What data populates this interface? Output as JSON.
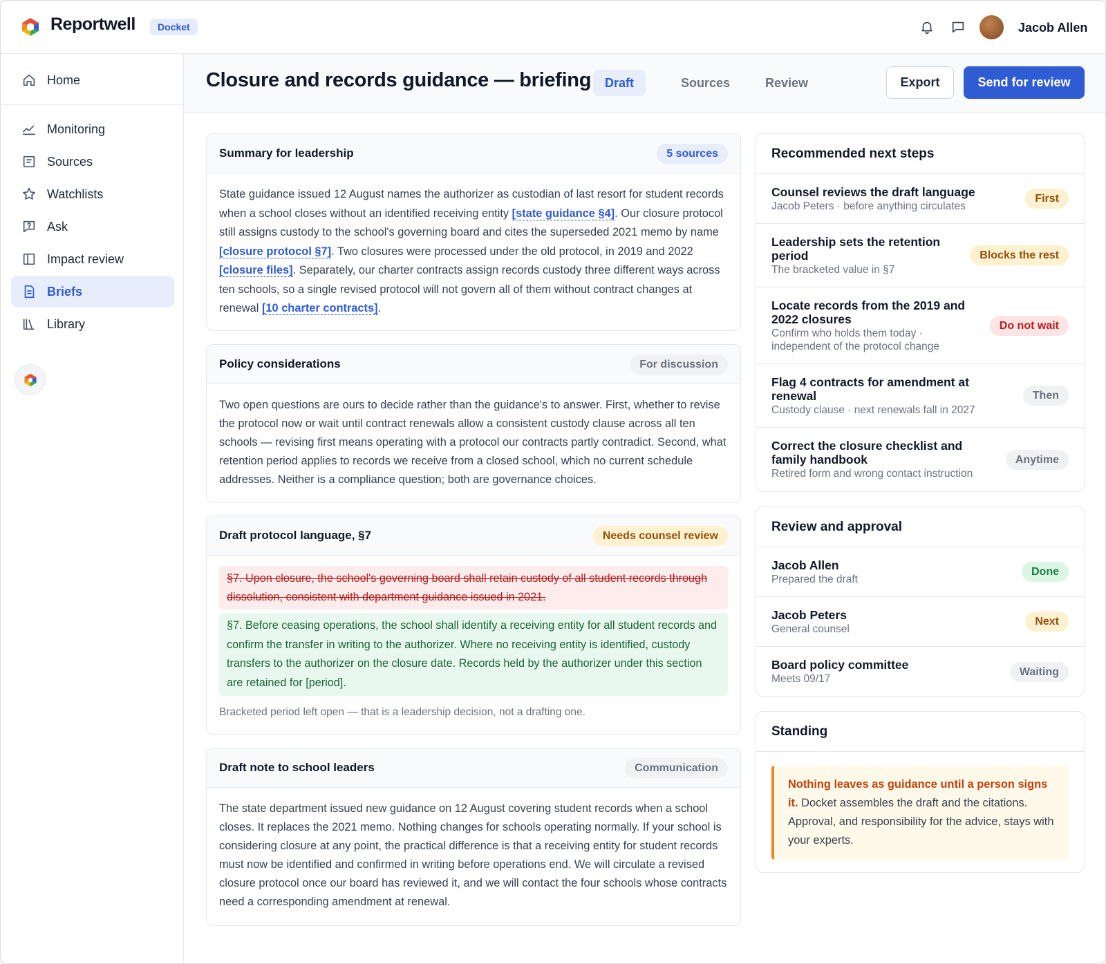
{
  "app": {
    "brand": "Reportwell",
    "product_badge": "Docket",
    "user_name": "Jacob Allen"
  },
  "sidebar": {
    "items": [
      {
        "label": "Home",
        "icon": "home-icon"
      },
      {
        "label": "Monitoring",
        "icon": "trend-icon"
      },
      {
        "label": "Sources",
        "icon": "document-icon"
      },
      {
        "label": "Watchlists",
        "icon": "star-icon"
      },
      {
        "label": "Ask",
        "icon": "chat-question-icon"
      },
      {
        "label": "Impact review",
        "icon": "columns-icon"
      },
      {
        "label": "Briefs",
        "icon": "brief-icon",
        "active": true
      },
      {
        "label": "Library",
        "icon": "library-icon"
      }
    ]
  },
  "header": {
    "title": "Closure and records guidance — briefing",
    "tabs": [
      "Draft",
      "Sources",
      "Review"
    ],
    "active_tab": "Draft",
    "export_label": "Export",
    "send_label": "Send for review"
  },
  "summary": {
    "title": "Summary for leadership",
    "badge": "5 sources",
    "p1": "State guidance issued 12 August names the authorizer as custodian of last resort for student records when a school closes without an identified receiving entity ",
    "c1": "[state guidance §4]",
    "p2": ". Our closure protocol still assigns custody to the school's governing board and cites the superseded 2021 memo by name ",
    "c2": "[closure protocol §7]",
    "p3": ". Two closures were processed under the old protocol, in 2019 and 2022 ",
    "c3": "[closure files]",
    "p4": ". Separately, our charter contracts assign records custody three different ways across ten schools, so a single revised protocol will not govern all of them without contract changes at renewal ",
    "c4": "[10 charter contracts]",
    "p5": "."
  },
  "policy": {
    "title": "Policy considerations",
    "badge": "For discussion",
    "text": "Two open questions are ours to decide rather than the guidance's to answer. First, whether to revise the protocol now or wait until contract renewals allow a consistent custody clause across all ten schools — revising first means operating with a protocol our contracts partly contradict. Second, what retention period applies to records we receive from a closed school, which no current schedule addresses. Neither is a compliance question; both are governance choices."
  },
  "draft": {
    "title": "Draft protocol language, §7",
    "badge": "Needs counsel review",
    "removed": "§7. Upon closure, the school's governing board shall retain custody of all student records through dissolution, consistent with department guidance issued in 2021.",
    "added": "§7. Before ceasing operations, the school shall identify a receiving entity for all student records and confirm the transfer in writing to the authorizer. Where no receiving entity is identified, custody transfers to the authorizer on the closure date. Records held by the authorizer under this section are retained for [period].",
    "note": "Bracketed period left open — that is a leadership decision, not a drafting one."
  },
  "note_to_leaders": {
    "title": "Draft note to school leaders",
    "badge": "Communication",
    "text": "The state department issued new guidance on 12 August covering student records when a school closes. It replaces the 2021 memo. Nothing changes for schools operating normally. If your school is considering closure at any point, the practical difference is that a receiving entity for student records must now be identified and confirmed in writing before operations end. We will circulate a revised closure protocol once our board has reviewed it, and we will contact the four schools whose contracts need a corresponding amendment at renewal."
  },
  "next_steps": {
    "title": "Recommended next steps",
    "items": [
      {
        "title": "Counsel reviews the draft language",
        "sub": "Jacob Peters · before anything circulates",
        "badge": "First",
        "tone": "amber"
      },
      {
        "title": "Leadership sets the retention period",
        "sub": "The bracketed value in §7",
        "badge": "Blocks the rest",
        "tone": "amber"
      },
      {
        "title": "Locate records from the 2019 and 2022 closures",
        "sub": "Confirm who holds them today · independent of the protocol change",
        "badge": "Do not wait",
        "tone": "red"
      },
      {
        "title": "Flag 4 contracts for amendment at renewal",
        "sub": "Custody clause · next renewals fall in 2027",
        "badge": "Then",
        "tone": "gray"
      },
      {
        "title": "Correct the closure checklist and family handbook",
        "sub": "Retired form and wrong contact instruction",
        "badge": "Anytime",
        "tone": "gray"
      }
    ]
  },
  "review": {
    "title": "Review and approval",
    "items": [
      {
        "name": "Jacob Allen",
        "sub": "Prepared the draft",
        "badge": "Done",
        "tone": "green"
      },
      {
        "name": "Jacob Peters",
        "sub": "General counsel",
        "badge": "Next",
        "tone": "amber"
      },
      {
        "name": "Board policy committee",
        "sub": "Meets 09/17",
        "badge": "Waiting",
        "tone": "gray"
      }
    ]
  },
  "standing": {
    "title": "Standing",
    "highlight": "Nothing leaves as guidance until a person signs it.",
    "text": " Docket assembles the draft and the citations. Approval, and responsibility for the advice, stays with your experts."
  },
  "colors": {
    "accent": "#2f5bd3",
    "active_bg": "#e7edfb",
    "warning_bar": "#e8862a"
  }
}
